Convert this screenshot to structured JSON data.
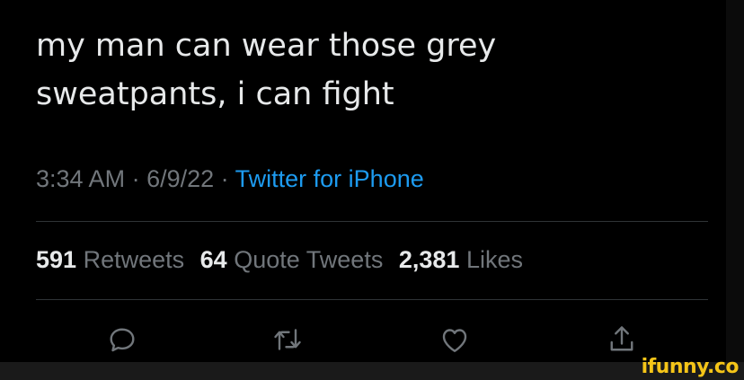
{
  "tweet": {
    "text_line1": "my man can wear those grey",
    "text_line2": "sweatpants, i can fight",
    "time": "3:34 AM",
    "separator": " · ",
    "date": "6/9/22",
    "source": "Twitter for iPhone"
  },
  "stats": {
    "retweets_count": "591",
    "retweets_label": "Retweets",
    "quotes_count": "64",
    "quotes_label": "Quote Tweets",
    "likes_count": "2,381",
    "likes_label": "Likes"
  },
  "actions": [
    {
      "icon": "reply-icon"
    },
    {
      "icon": "retweet-icon"
    },
    {
      "icon": "like-icon"
    },
    {
      "icon": "share-icon"
    }
  ],
  "watermark": "ifunny.co",
  "colors": {
    "background": "#000000",
    "text": "#e7e9ea",
    "muted": "#71767b",
    "link": "#1d9bf0",
    "divider": "#2f3336",
    "watermark": "#f5c518"
  }
}
